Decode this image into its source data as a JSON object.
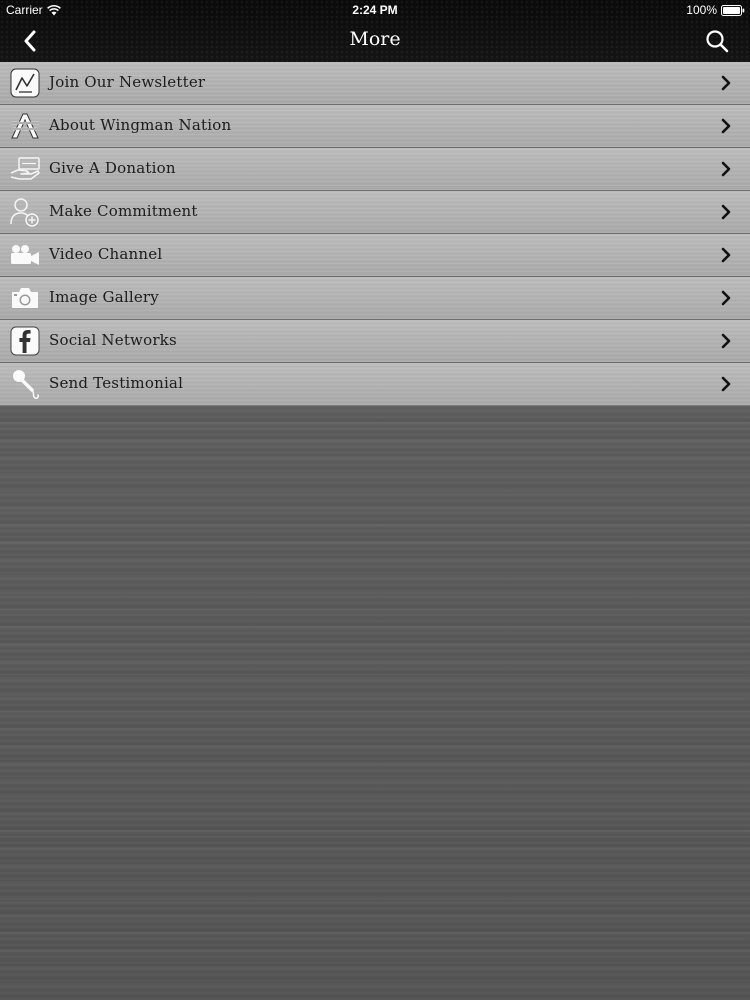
{
  "status_bar": {
    "carrier": "Carrier",
    "time": "2:24 PM",
    "battery": "100%"
  },
  "nav": {
    "title": "More",
    "back_icon": "chevron-left-icon",
    "search_icon": "search-icon"
  },
  "menu": {
    "items": [
      {
        "label": "Join Our Newsletter",
        "icon": "newsletter-icon"
      },
      {
        "label": "About Wingman Nation",
        "icon": "about-icon"
      },
      {
        "label": "Give A Donation",
        "icon": "donation-icon"
      },
      {
        "label": "Make Commitment",
        "icon": "add-user-icon"
      },
      {
        "label": "Video Channel",
        "icon": "video-camera-icon"
      },
      {
        "label": "Image Gallery",
        "icon": "camera-icon"
      },
      {
        "label": "Social Networks",
        "icon": "facebook-icon"
      },
      {
        "label": "Send Testimonial",
        "icon": "microphone-icon"
      }
    ]
  }
}
